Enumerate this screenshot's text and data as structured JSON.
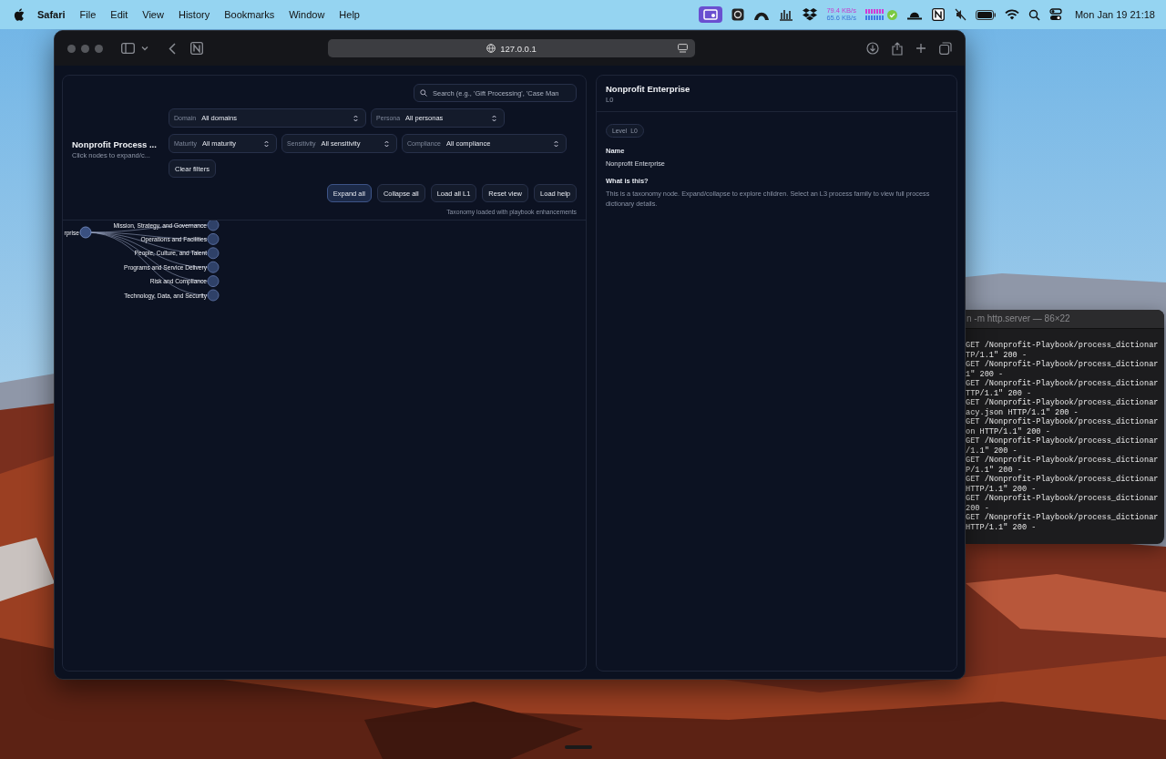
{
  "menu_bar": {
    "app_name": "Safari",
    "menus": [
      "File",
      "Edit",
      "View",
      "History",
      "Bookmarks",
      "Window",
      "Help"
    ],
    "net_upload": "79.4 KB/s",
    "net_download": "65.6 KB/s",
    "clock": "Mon Jan 19  21:18"
  },
  "browser": {
    "url": "127.0.0.1"
  },
  "app": {
    "title": "Nonprofit Process ...",
    "subtitle": "Click nodes to expand/c...",
    "search": {
      "placeholder": "Search (e.g., 'Gift Processing', 'Case Man"
    },
    "filter_rows": [
      [
        {
          "label": "Domain",
          "value": "All domains"
        },
        {
          "label": "Persona",
          "value": "All personas"
        }
      ],
      [
        {
          "label": "Maturity",
          "value": "All maturity"
        },
        {
          "label": "Sensitivity",
          "value": "All sensitivity"
        },
        {
          "label": "Compliance",
          "value": "All compliance"
        }
      ]
    ],
    "clear_filters": "Clear filters",
    "actions": [
      {
        "label": "Expand all",
        "selected": true
      },
      {
        "label": "Collapse all",
        "selected": false
      },
      {
        "label": "Load all L1",
        "selected": false
      },
      {
        "label": "Reset view",
        "selected": false
      },
      {
        "label": "Load help",
        "selected": false
      }
    ],
    "status": "Taxonomy loaded with playbook enhancements",
    "tree": {
      "label": "rprise",
      "children": [
        {
          "label": "Mission, Strategy, and Governance"
        },
        {
          "label": "Operations and Facilities"
        },
        {
          "label": "People, Culture, and Talent"
        },
        {
          "label": "Programs and Service Delivery"
        },
        {
          "label": "Risk and Compliance"
        },
        {
          "label": "Technology, Data, and Security"
        }
      ]
    }
  },
  "detail": {
    "title": "Nonprofit Enterprise",
    "subtitle": "L0",
    "badge_label": "Level",
    "badge_value": "L0",
    "fields": [
      {
        "heading": "Name",
        "text": "Nonprofit Enterprise"
      },
      {
        "heading": "What is this?",
        "text": "This is a taxonomy node. Expand/collapse to explore children. Select an L3 process family to view full process dictionary details."
      }
    ]
  },
  "terminal": {
    "title": "n -m http.server — 86×22",
    "lines": [
      "GET /Nonprofit-Playbook/process_dictionar",
      "TP/1.1\" 200 -",
      "GET /Nonprofit-Playbook/process_dictionar",
      "1\" 200 -",
      "GET /Nonprofit-Playbook/process_dictionar",
      "TTP/1.1\" 200 -",
      "GET /Nonprofit-Playbook/process_dictionar",
      "acy.json HTTP/1.1\" 200 -",
      "GET /Nonprofit-Playbook/process_dictionar",
      "on HTTP/1.1\" 200 -",
      "GET /Nonprofit-Playbook/process_dictionar",
      "/1.1\" 200 -",
      "GET /Nonprofit-Playbook/process_dictionar",
      "P/1.1\" 200 -",
      "GET /Nonprofit-Playbook/process_dictionar",
      "HTTP/1.1\" 200 -",
      "GET /Nonprofit-Playbook/process_dictionar",
      "200 -",
      "GET /Nonprofit-Playbook/process_dictionar",
      "HTTP/1.1\" 200 -"
    ]
  }
}
